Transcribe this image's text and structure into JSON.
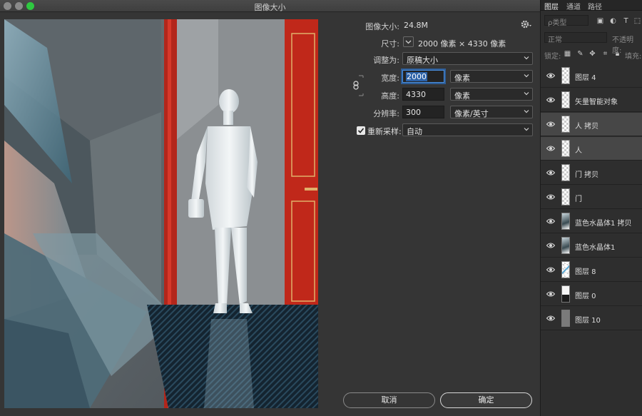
{
  "window": {
    "title": "图像大小"
  },
  "form": {
    "image_size_label": "图像大小:",
    "image_size_value": "24.8M",
    "dimensions_label": "尺寸:",
    "dimensions_value": "2000 像素  ×  4330 像素",
    "fit_to_label": "调整为:",
    "fit_to_value": "原稿大小",
    "width_label": "宽度:",
    "width_value": "2000",
    "width_unit": "像素",
    "height_label": "高度:",
    "height_value": "4330",
    "height_unit": "像素",
    "resolution_label": "分辨率:",
    "resolution_value": "300",
    "resolution_unit": "像素/英寸",
    "resample_label": "重新采样:",
    "resample_checked": true,
    "resample_value": "自动"
  },
  "buttons": {
    "cancel": "取消",
    "ok": "确定"
  },
  "panel": {
    "tabs": [
      "图层",
      "通道",
      "路径"
    ],
    "filter_kind": "ρ类型",
    "blend_mode": "正常",
    "opacity_label": "不透明度:",
    "lock_label": "锁定:",
    "fill_label": "填充:",
    "layers": [
      {
        "name": "图层 4",
        "thumb": "transparent",
        "highlighted": false
      },
      {
        "name": "矢量智能对象",
        "thumb": "transparent",
        "highlighted": false
      },
      {
        "name": "人 拷贝",
        "thumb": "transparent",
        "highlighted": true
      },
      {
        "name": "人",
        "thumb": "transparent",
        "highlighted": true
      },
      {
        "name": "门 拷贝",
        "thumb": "transparent",
        "highlighted": false
      },
      {
        "name": "门",
        "thumb": "transparent",
        "highlighted": false
      },
      {
        "name": "蓝色水晶体1 拷贝",
        "thumb": "crystal",
        "highlighted": false
      },
      {
        "name": "蓝色水晶体1",
        "thumb": "crystal",
        "highlighted": false
      },
      {
        "name": "图层 8",
        "thumb": "line",
        "highlighted": false
      },
      {
        "name": "图层 0",
        "thumb": "dark",
        "highlighted": false
      },
      {
        "name": "图层 10",
        "thumb": "gray",
        "highlighted": false
      }
    ]
  },
  "colors": {
    "accent": "#2e63a8",
    "door_red": "#c0281a",
    "traffic_green": "#2ec840"
  }
}
